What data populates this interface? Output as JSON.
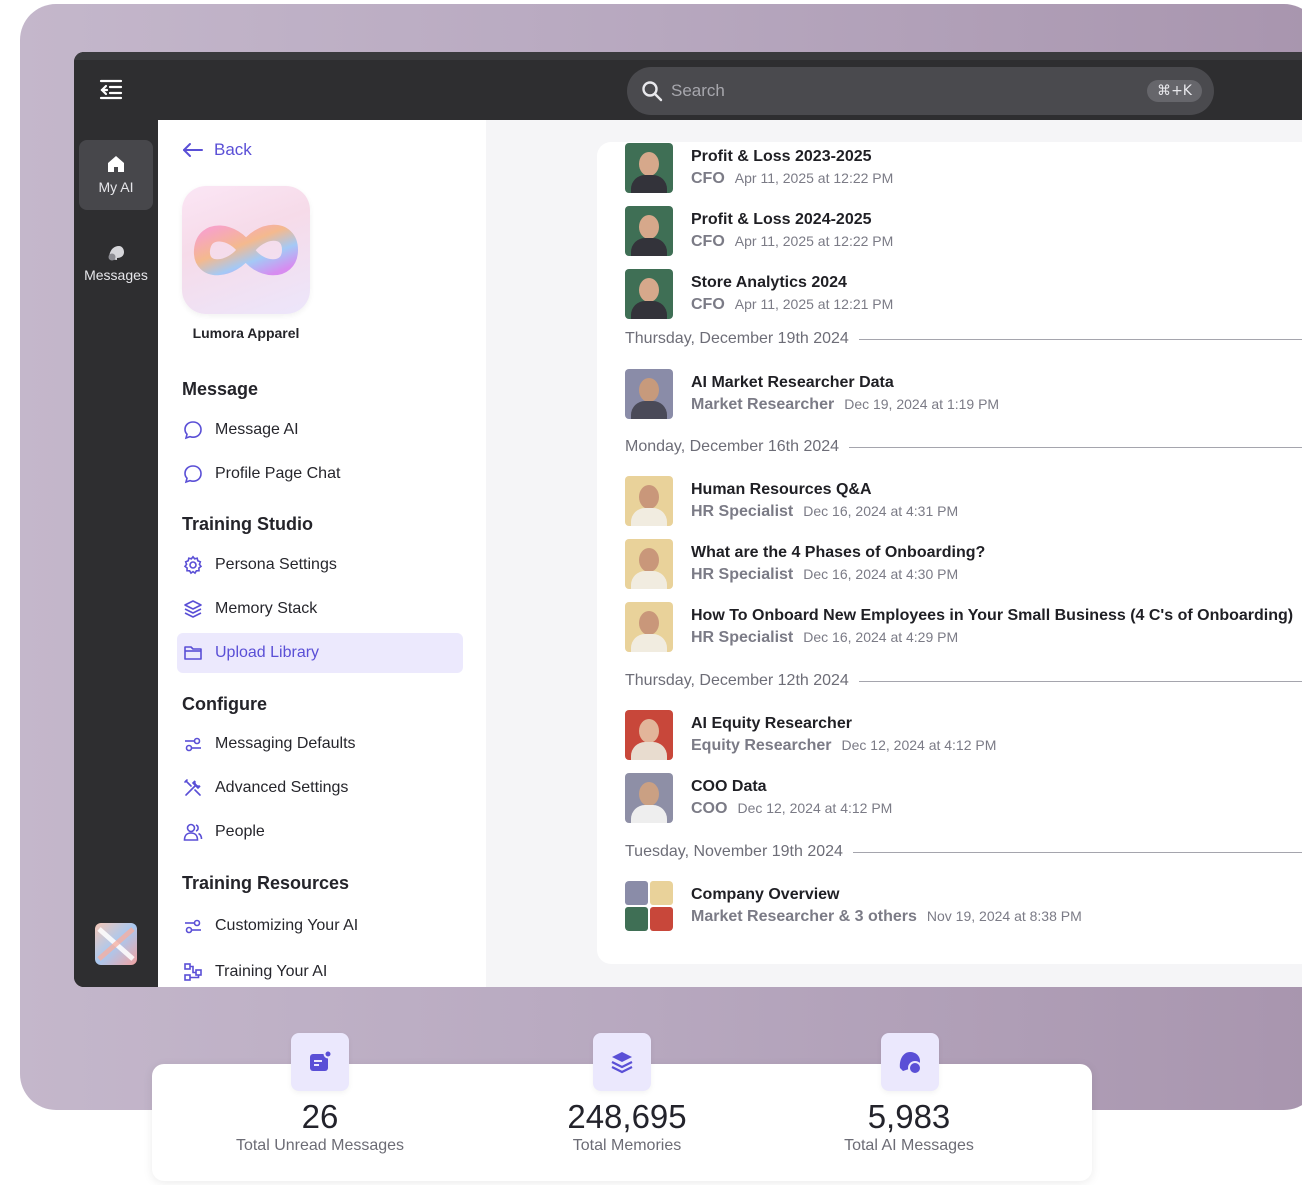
{
  "search": {
    "placeholder": "Search",
    "shortcut": "⌘+K"
  },
  "rail": {
    "items": [
      {
        "label": "My AI",
        "icon": "home-icon",
        "active": true
      },
      {
        "label": "Messages",
        "icon": "messages-icon",
        "active": false
      }
    ]
  },
  "sidebar": {
    "back_label": "Back",
    "brand_name": "Lumora Apparel",
    "sections": [
      {
        "title": "Message",
        "items": [
          {
            "label": "Message AI",
            "icon": "chat-bubble-icon"
          },
          {
            "label": "Profile Page Chat",
            "icon": "chat-bubble-icon"
          }
        ]
      },
      {
        "title": "Training Studio",
        "items": [
          {
            "label": "Persona Settings",
            "icon": "gear-icon"
          },
          {
            "label": "Memory Stack",
            "icon": "layers-icon"
          },
          {
            "label": "Upload Library",
            "icon": "folder-icon",
            "active": true
          }
        ]
      },
      {
        "title": "Configure",
        "items": [
          {
            "label": "Messaging Defaults",
            "icon": "sliders-icon"
          },
          {
            "label": "Advanced Settings",
            "icon": "tools-icon"
          },
          {
            "label": "People",
            "icon": "people-icon"
          }
        ]
      },
      {
        "title": "Training Resources",
        "items": [
          {
            "label": "Customizing Your AI",
            "icon": "sliders-icon"
          },
          {
            "label": "Training Your AI",
            "icon": "workflow-icon"
          }
        ]
      }
    ]
  },
  "conversations": {
    "groups": [
      {
        "date": "",
        "items": [
          {
            "title": "Profit & Loss 2023-2025",
            "role": "CFO",
            "time": "Apr 11, 2025 at 12:22 PM"
          },
          {
            "title": "Profit & Loss 2024-2025",
            "role": "CFO",
            "time": "Apr 11, 2025 at 12:22 PM"
          },
          {
            "title": "Store Analytics 2024",
            "role": "CFO",
            "time": "Apr 11, 2025 at 12:21 PM"
          }
        ]
      },
      {
        "date": "Thursday, December 19th 2024",
        "items": [
          {
            "title": "AI Market Researcher Data",
            "role": "Market Researcher",
            "time": "Dec 19, 2024 at 1:19 PM"
          }
        ]
      },
      {
        "date": "Monday, December 16th 2024",
        "items": [
          {
            "title": "Human Resources Q&A",
            "role": "HR Specialist",
            "time": "Dec 16, 2024 at 4:31 PM"
          },
          {
            "title": "What are the 4 Phases of Onboarding?",
            "role": "HR Specialist",
            "time": "Dec 16, 2024 at 4:30 PM"
          },
          {
            "title": "How To Onboard New Employees in Your Small Business (4 C's of Onboarding)",
            "role": "HR Specialist",
            "time": "Dec 16, 2024 at 4:29 PM"
          }
        ]
      },
      {
        "date": "Thursday, December 12th 2024",
        "items": [
          {
            "title": "AI Equity Researcher",
            "role": "Equity Researcher",
            "time": "Dec 12, 2024 at 4:12 PM"
          },
          {
            "title": "COO Data",
            "role": "COO",
            "time": "Dec 12, 2024 at 4:12 PM"
          }
        ]
      },
      {
        "date": "Tuesday, November 19th 2024",
        "items": [
          {
            "title": "Company Overview",
            "role": "Market Researcher & 3 others",
            "time": "Nov 19, 2024 at 8:38 PM"
          }
        ]
      }
    ]
  },
  "stats": [
    {
      "value": "26",
      "label": "Total Unread Messages",
      "icon": "unread-message-icon"
    },
    {
      "value": "248,695",
      "label": "Total Memories",
      "icon": "layers-icon"
    },
    {
      "value": "5,983",
      "label": "Total AI Messages",
      "icon": "chat-bubbles-icon"
    }
  ],
  "colors": {
    "accent": "#5a4fd6",
    "accent_bg": "#ece9fd",
    "chrome": "#2e2e30"
  }
}
